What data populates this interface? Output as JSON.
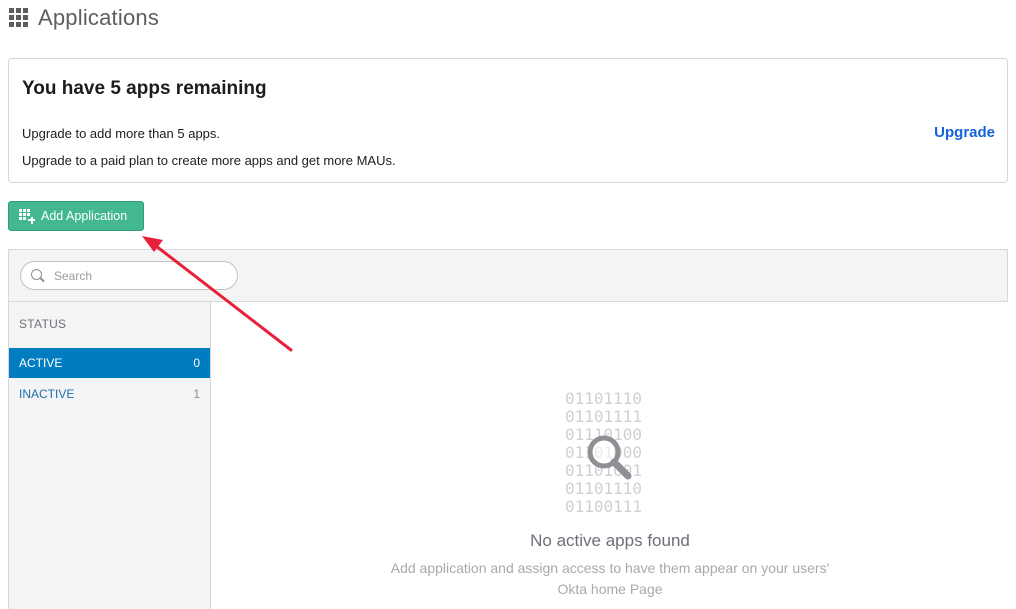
{
  "header": {
    "title": "Applications",
    "icon": "apps-grid-icon"
  },
  "notice": {
    "title": "You have 5 apps remaining",
    "line1": "Upgrade to add more than 5 apps.",
    "line2": "Upgrade to a paid plan to create more apps and get more MAUs.",
    "upgrade_label": "Upgrade"
  },
  "toolbar": {
    "add_application_label": "Add Application",
    "add_application_icon": "add-app-grid-icon"
  },
  "search": {
    "placeholder": "Search",
    "value": ""
  },
  "sidebar": {
    "header": "STATUS",
    "items": [
      {
        "label": "ACTIVE",
        "count": "0",
        "selected": true
      },
      {
        "label": "INACTIVE",
        "count": "1",
        "selected": false
      }
    ]
  },
  "empty_state": {
    "binary_lines": [
      "01101110",
      "01101111",
      "01110100",
      "01101000",
      "01101001",
      "01101110",
      "01100111"
    ],
    "title": "No active apps found",
    "description_line1": "Add application and assign access to have them appear on your users'",
    "description_line2": "Okta home Page",
    "icon": "magnifier-icon"
  },
  "colors": {
    "accent_blue": "#007dc1",
    "link_blue": "#1662dd",
    "button_green": "#43b88f",
    "annotation_red": "#e8203c"
  }
}
